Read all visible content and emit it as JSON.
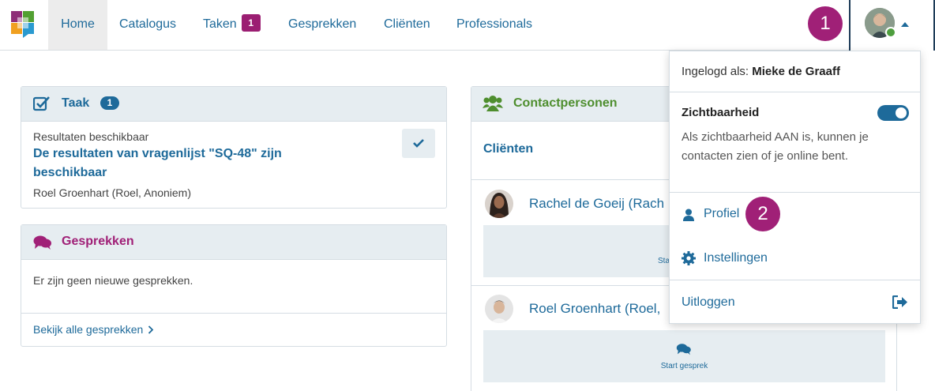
{
  "nav": {
    "items": [
      {
        "label": "Home"
      },
      {
        "label": "Catalogus"
      },
      {
        "label": "Taken",
        "badge": "1"
      },
      {
        "label": "Gesprekken"
      },
      {
        "label": "Cliënten"
      },
      {
        "label": "Professionals"
      }
    ],
    "step1": "1",
    "step2": "2"
  },
  "taak": {
    "title": "Taak",
    "count": "1",
    "type": "Resultaten beschikbaar",
    "heading": "De resultaten van vragenlijst \"SQ-48\" zijn beschikbaar",
    "person": "Roel Groenhart (Roel, Anoniem)"
  },
  "gesprekken": {
    "title": "Gesprekken",
    "empty": "Er zijn geen nieuwe gesprekken.",
    "link": "Bekijk alle gesprekken"
  },
  "contacts": {
    "title": "Contactpersonen",
    "section": "Cliënten",
    "people": [
      {
        "name": "Rachel de Goeij (Rach",
        "action": "Start gesprek",
        "action_visible": "Sta"
      },
      {
        "name": "Roel Groenhart (Roel,",
        "action": "Start gesprek"
      }
    ]
  },
  "dropdown": {
    "logged_in_label": "Ingelogd als:",
    "user_name": "Mieke de Graaff",
    "visibility_title": "Zichtbaarheid",
    "visibility_text": "Als zichtbaarheid AAN is, kunnen je contacten zien of je online bent.",
    "visibility_on": true,
    "profile": "Profiel",
    "settings": "Instellingen",
    "logout": "Uitloggen"
  },
  "colors": {
    "primary": "#1e6a9a",
    "accent": "#9b1e72",
    "green": "#4e8e2e",
    "card_header": "#e6edf1"
  }
}
